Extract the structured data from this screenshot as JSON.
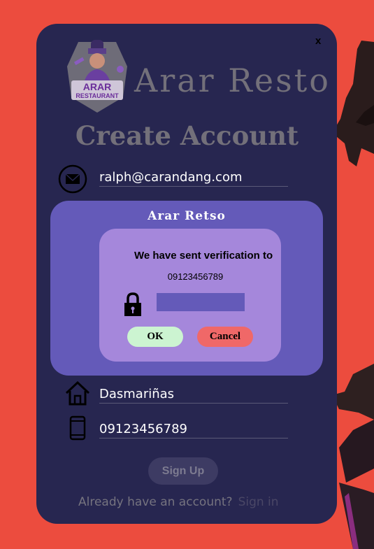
{
  "app": {
    "brand": "Arar Resto",
    "close_label": "x",
    "logo_text": {
      "line1": "ARAR",
      "line2": "RESTAURANT"
    }
  },
  "form": {
    "heading": "Create Account",
    "email": "ralph@carandang.com",
    "address": "Dasmariñas",
    "phone": "09123456789",
    "signup_label": "Sign Up",
    "already_text": "Already have an account?",
    "signin_label": "Sign in"
  },
  "modal": {
    "title": "Arar Retso",
    "message": "We have sent verification to",
    "phone": "09123456789",
    "code_value": "",
    "ok_label": "OK",
    "cancel_label": "Cancel"
  },
  "colors": {
    "page_bg": "#ec4c3e",
    "card_bg": "#272650",
    "overlay_bg": "#645ab9",
    "dialog_bg": "#a587db",
    "ok_bg": "#ccf4d1",
    "cancel_bg": "#f06868"
  },
  "icons": [
    "envelope-icon",
    "home-icon",
    "phone-icon",
    "lock-icon"
  ]
}
